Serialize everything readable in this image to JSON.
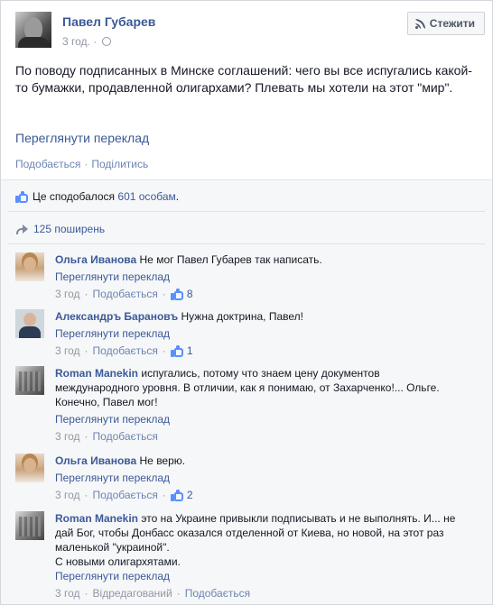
{
  "post": {
    "author": "Павел Губарев",
    "time": "3 год.",
    "meta_sep": "·",
    "follow_label": "Стежити",
    "text": "По поводу подписанных в Минске соглашений: чего вы все испугались какой-то бумажки, продавленной олигархами? Плевать мы хотели на этот \"мир\".",
    "translate_label": "Переглянути переклад",
    "actions": {
      "like": "Подобається",
      "sep": "·",
      "share": "Поділитись"
    }
  },
  "ufi": {
    "likes_prefix": "Це сподобалося",
    "likes_count": "601 особам",
    "likes_suffix": ".",
    "shares": "125 поширень"
  },
  "comments": [
    {
      "author": "Ольга Иванова",
      "text": "Не мог Павел Губарев так написать.",
      "translate": "Переглянути переклад",
      "time": "3 год",
      "like_label": "Подобається",
      "likes": "8"
    },
    {
      "author": "Александръ Барановъ",
      "text": "Нужна доктрина, Павел!",
      "translate": "Переглянути переклад",
      "time": "3 год",
      "like_label": "Подобається",
      "likes": "1"
    },
    {
      "author": "Roman Manekin",
      "text": "испугались, потому что знаем цену документов международного уровня. В отличии, как я понимаю, от Захарченко!... Ольге. Конечно, Павел мог!",
      "translate": "Переглянути переклад",
      "time": "3 год",
      "like_label": "Подобається",
      "likes": ""
    },
    {
      "author": "Ольга Иванова",
      "text": "Не верю.",
      "translate": "Переглянути переклад",
      "time": "3 год",
      "like_label": "Подобається",
      "likes": "2"
    },
    {
      "author": "Roman Manekin",
      "text": "это на Украине привыкли подписывать и не выполнять. И... не дай Бог, чтобы Донбасс оказался отделенной от Киева, но новой, на этот раз маленькой \"украиной\".",
      "text2": "С новыми олигархятами.",
      "translate": "Переглянути переклад",
      "time": "3 год",
      "edited": "Відредагований",
      "like_label": "Подобається",
      "likes": ""
    }
  ],
  "meta_sep": "·",
  "colors": {
    "link": "#3b5998",
    "muted": "#9197a3",
    "like_blue": "#5890ff"
  }
}
